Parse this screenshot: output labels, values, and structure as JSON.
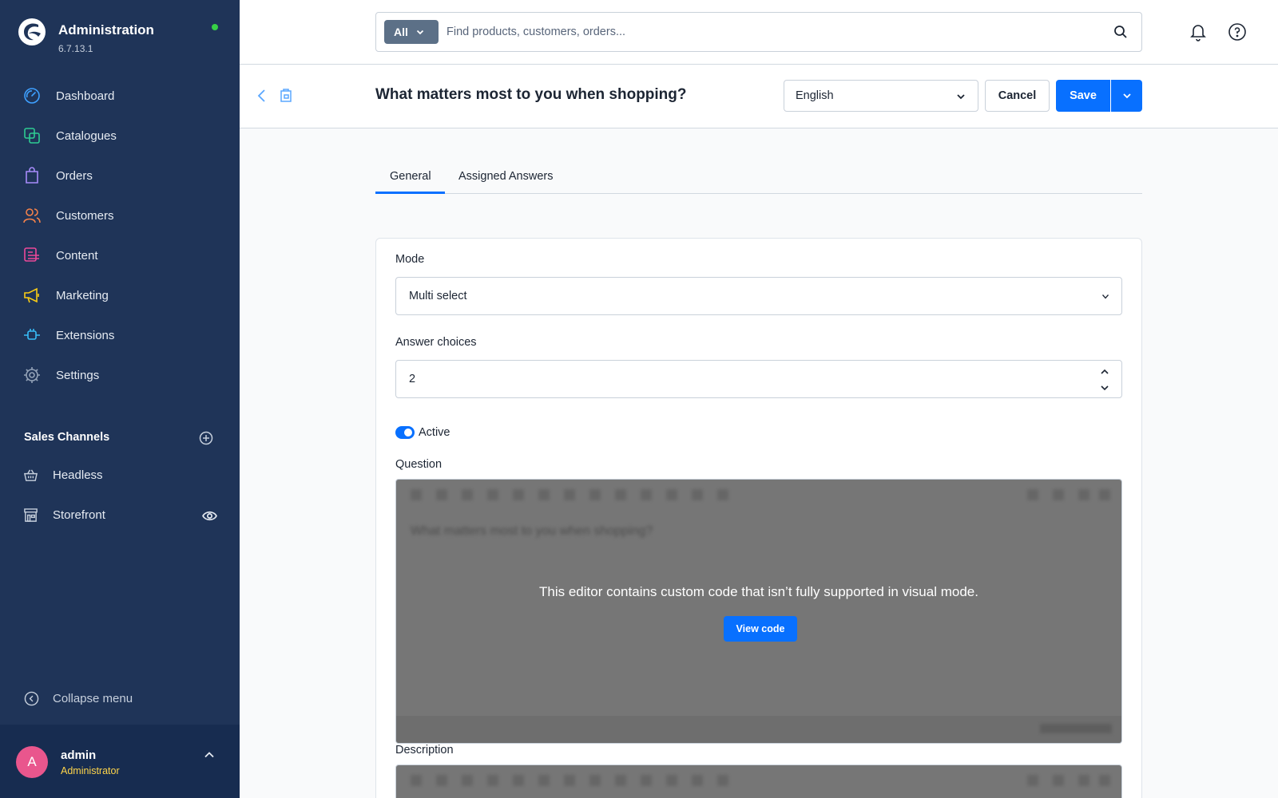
{
  "app": {
    "title": "Administration",
    "version": "6.7.13.1"
  },
  "sidebar": {
    "items": [
      {
        "label": "Dashboard",
        "icon": "dashboard-icon"
      },
      {
        "label": "Catalogues",
        "icon": "catalogue-icon"
      },
      {
        "label": "Orders",
        "icon": "shopping-bag-icon"
      },
      {
        "label": "Customers",
        "icon": "users-icon"
      },
      {
        "label": "Content",
        "icon": "content-icon"
      },
      {
        "label": "Marketing",
        "icon": "megaphone-icon"
      },
      {
        "label": "Extensions",
        "icon": "plug-icon"
      },
      {
        "label": "Settings",
        "icon": "gear-icon"
      }
    ],
    "sales_channels_title": "Sales Channels",
    "sales_channels": [
      {
        "label": "Headless",
        "icon": "basket-icon"
      },
      {
        "label": "Storefront",
        "icon": "storefront-icon"
      }
    ],
    "collapse_label": "Collapse menu",
    "user": {
      "initial": "A",
      "name": "admin",
      "role": "Administrator"
    }
  },
  "topbar": {
    "search_scope": "All",
    "search_placeholder": "Find products, customers, orders..."
  },
  "header": {
    "title": "What matters most to you when shopping?",
    "language": "English",
    "cancel_label": "Cancel",
    "save_label": "Save"
  },
  "tabs": [
    {
      "label": "General",
      "active": true
    },
    {
      "label": "Assigned Answers",
      "active": false
    }
  ],
  "form": {
    "mode_label": "Mode",
    "mode_value": "Multi select",
    "answer_choices_label": "Answer choices",
    "answer_choices_value": "2",
    "active_label": "Active",
    "active": true,
    "question_label": "Question",
    "question_blurred_text": "What matters most to you when shopping?",
    "editor_message": "This editor contains custom code that isn’t fully supported in visual mode.",
    "view_code_label": "View code",
    "description_label": "Description"
  },
  "colors": {
    "sidebar_bg": "#1f3458",
    "primary": "#0870ff",
    "status_online": "#37d046",
    "avatar": "#e9568d",
    "role_text": "#ffd54a"
  }
}
